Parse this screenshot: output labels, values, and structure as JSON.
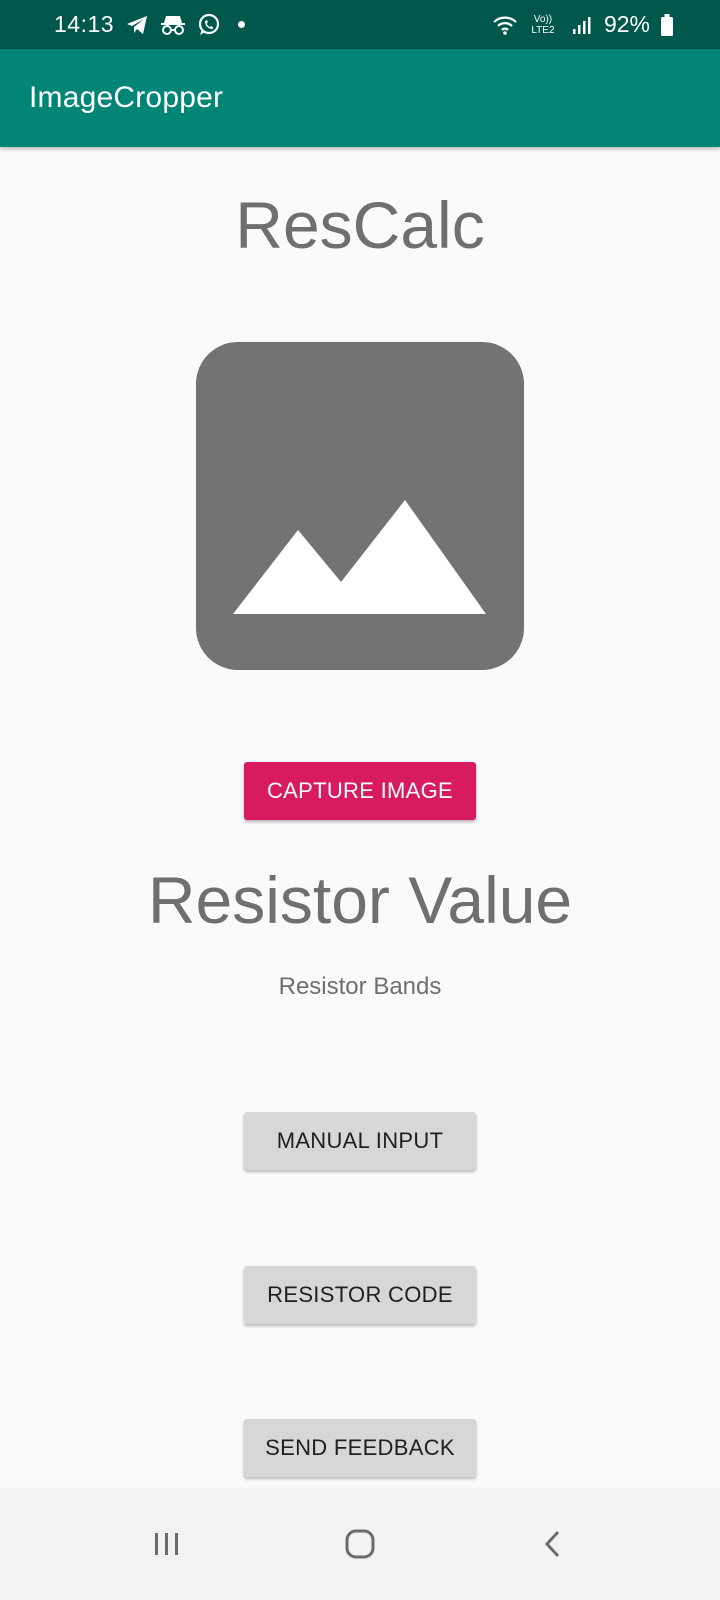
{
  "status_bar": {
    "time": "14:13",
    "network_label": "Vo)) LTE2",
    "battery": "92%",
    "icons": [
      "telegram-icon",
      "incognito-icon",
      "whatsapp-icon",
      "wifi-icon",
      "signal-icon",
      "battery-icon"
    ]
  },
  "app_bar": {
    "title": "ImageCropper"
  },
  "main": {
    "app_name": "ResCalc",
    "image_placeholder_icon": "image-placeholder-icon",
    "capture_button": "CAPTURE IMAGE",
    "resistor_value": "Resistor Value",
    "resistor_bands": "Resistor Bands",
    "manual_input_button": "MANUAL INPUT",
    "resistor_code_button": "RESISTOR CODE",
    "send_feedback_button": "SEND FEEDBACK"
  },
  "nav_bar": {
    "items": [
      "recent-apps-icon",
      "home-icon",
      "back-icon"
    ]
  },
  "colors": {
    "status_bar": "#00574b",
    "app_bar": "#008577",
    "accent": "#d81b60",
    "secondary_button": "#d6d7d7",
    "text_gray": "#6f6f6f"
  }
}
